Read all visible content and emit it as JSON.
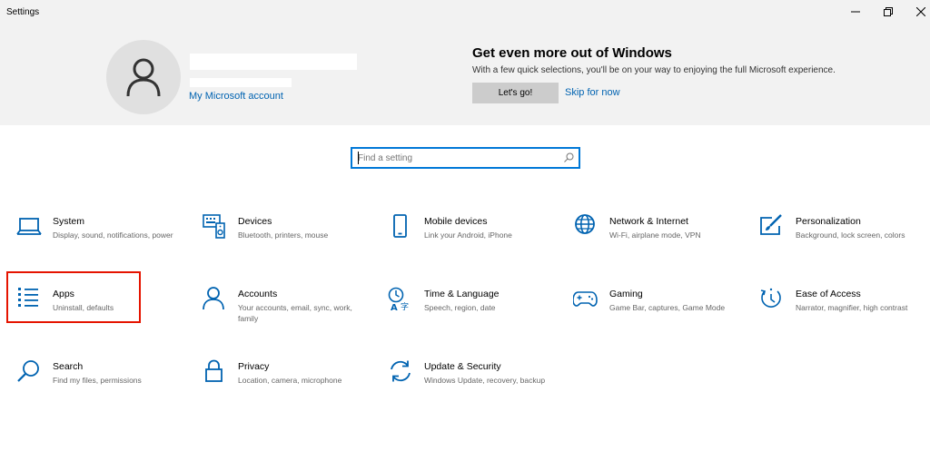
{
  "window": {
    "title": "Settings"
  },
  "account": {
    "link": "My Microsoft account"
  },
  "promo": {
    "title": "Get even more out of Windows",
    "subtitle": "With a few quick selections, you'll be on your way to enjoying the full Microsoft experience.",
    "primary_label": "Let's go!",
    "secondary_label": "Skip for now"
  },
  "search": {
    "placeholder": "Find a setting",
    "value": ""
  },
  "accent_color": "#0063b1",
  "tiles": [
    {
      "label": "System",
      "desc": "Display, sound, notifications, power",
      "icon": "laptop-icon"
    },
    {
      "label": "Devices",
      "desc": "Bluetooth, printers, mouse",
      "icon": "keyboard-speaker-icon"
    },
    {
      "label": "Mobile devices",
      "desc": "Link your Android, iPhone",
      "icon": "phone-icon"
    },
    {
      "label": "Network & Internet",
      "desc": "Wi-Fi, airplane mode, VPN",
      "icon": "globe-icon"
    },
    {
      "label": "Personalization",
      "desc": "Background, lock screen, colors",
      "icon": "paintbrush-icon"
    },
    {
      "label": "Apps",
      "desc": "Uninstall, defaults",
      "icon": "apps-list-icon"
    },
    {
      "label": "Accounts",
      "desc": "Your accounts, email, sync, work, family",
      "icon": "person-icon"
    },
    {
      "label": "Time & Language",
      "desc": "Speech, region, date",
      "icon": "time-language-icon"
    },
    {
      "label": "Gaming",
      "desc": "Game Bar, captures, Game Mode",
      "icon": "gamepad-icon"
    },
    {
      "label": "Ease of Access",
      "desc": "Narrator, magnifier, high contrast",
      "icon": "ease-of-access-icon"
    },
    {
      "label": "Search",
      "desc": "Find my files, permissions",
      "icon": "search-icon"
    },
    {
      "label": "Privacy",
      "desc": "Location, camera, microphone",
      "icon": "lock-icon"
    },
    {
      "label": "Update & Security",
      "desc": "Windows Update, recovery, backup",
      "icon": "sync-arrows-icon"
    }
  ]
}
